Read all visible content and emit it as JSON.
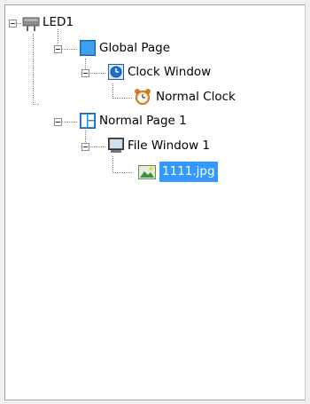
{
  "tree": {
    "root": {
      "label": "LED1",
      "icon": "led-screen-icon",
      "children": [
        {
          "label": "Global Page",
          "icon": "global-page-icon",
          "children": [
            {
              "label": "Clock Window",
              "icon": "clock-window-icon",
              "children": [
                {
                  "label": "Normal Clock",
                  "icon": "alarm-clock-icon"
                }
              ]
            }
          ]
        },
        {
          "label": "Normal Page 1",
          "icon": "normal-page-icon",
          "children": [
            {
              "label": "File Window 1",
              "icon": "file-window-icon",
              "children": [
                {
                  "label": "1111.jpg",
                  "icon": "image-file-icon",
                  "selected": true
                }
              ]
            }
          ]
        }
      ]
    }
  },
  "colors": {
    "selection": "#3399ff",
    "selection_text": "#ffffff",
    "tree_lines": "#8a8a8a",
    "panel_border": "#a0a0a0"
  }
}
